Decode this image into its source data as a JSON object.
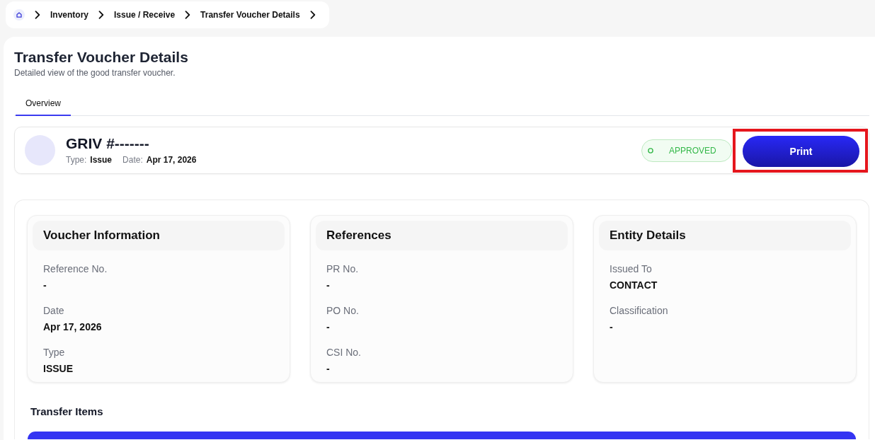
{
  "breadcrumb": [
    {
      "label": "Inventory"
    },
    {
      "label": "Issue / Receive"
    },
    {
      "label": "Transfer Voucher Details"
    }
  ],
  "page": {
    "title": "Transfer Voucher Details",
    "subtitle": "Detailed view of the good transfer voucher."
  },
  "tabs": [
    {
      "label": "Overview",
      "selected": true
    }
  ],
  "voucher": {
    "number": "GRIV #-------",
    "meta": [
      {
        "label": "Type:",
        "value": "Issue"
      },
      {
        "label": "Date:",
        "value": "Apr 17, 2026"
      }
    ],
    "status": {
      "label": "APPROVED",
      "kind": "approved"
    }
  },
  "print_button": {
    "label": "Print",
    "highlighted": true
  },
  "sections": [
    {
      "title": "Voucher Information",
      "fields": [
        {
          "label": "Reference No.",
          "value": "-"
        },
        {
          "label": "Date",
          "value": "Apr 17, 2026"
        },
        {
          "label": "Type",
          "value": "ISSUE"
        }
      ]
    },
    {
      "title": "References",
      "fields": [
        {
          "label": "PR No.",
          "value": "-"
        },
        {
          "label": "PO No.",
          "value": "-"
        },
        {
          "label": "CSI No.",
          "value": "-"
        }
      ]
    },
    {
      "title": "Entity Details",
      "fields": [
        {
          "label": "Issued To",
          "value": "CONTACT"
        },
        {
          "label": "Classification",
          "value": "-"
        }
      ]
    }
  ],
  "transfer_items": {
    "title": "Transfer Items"
  }
}
